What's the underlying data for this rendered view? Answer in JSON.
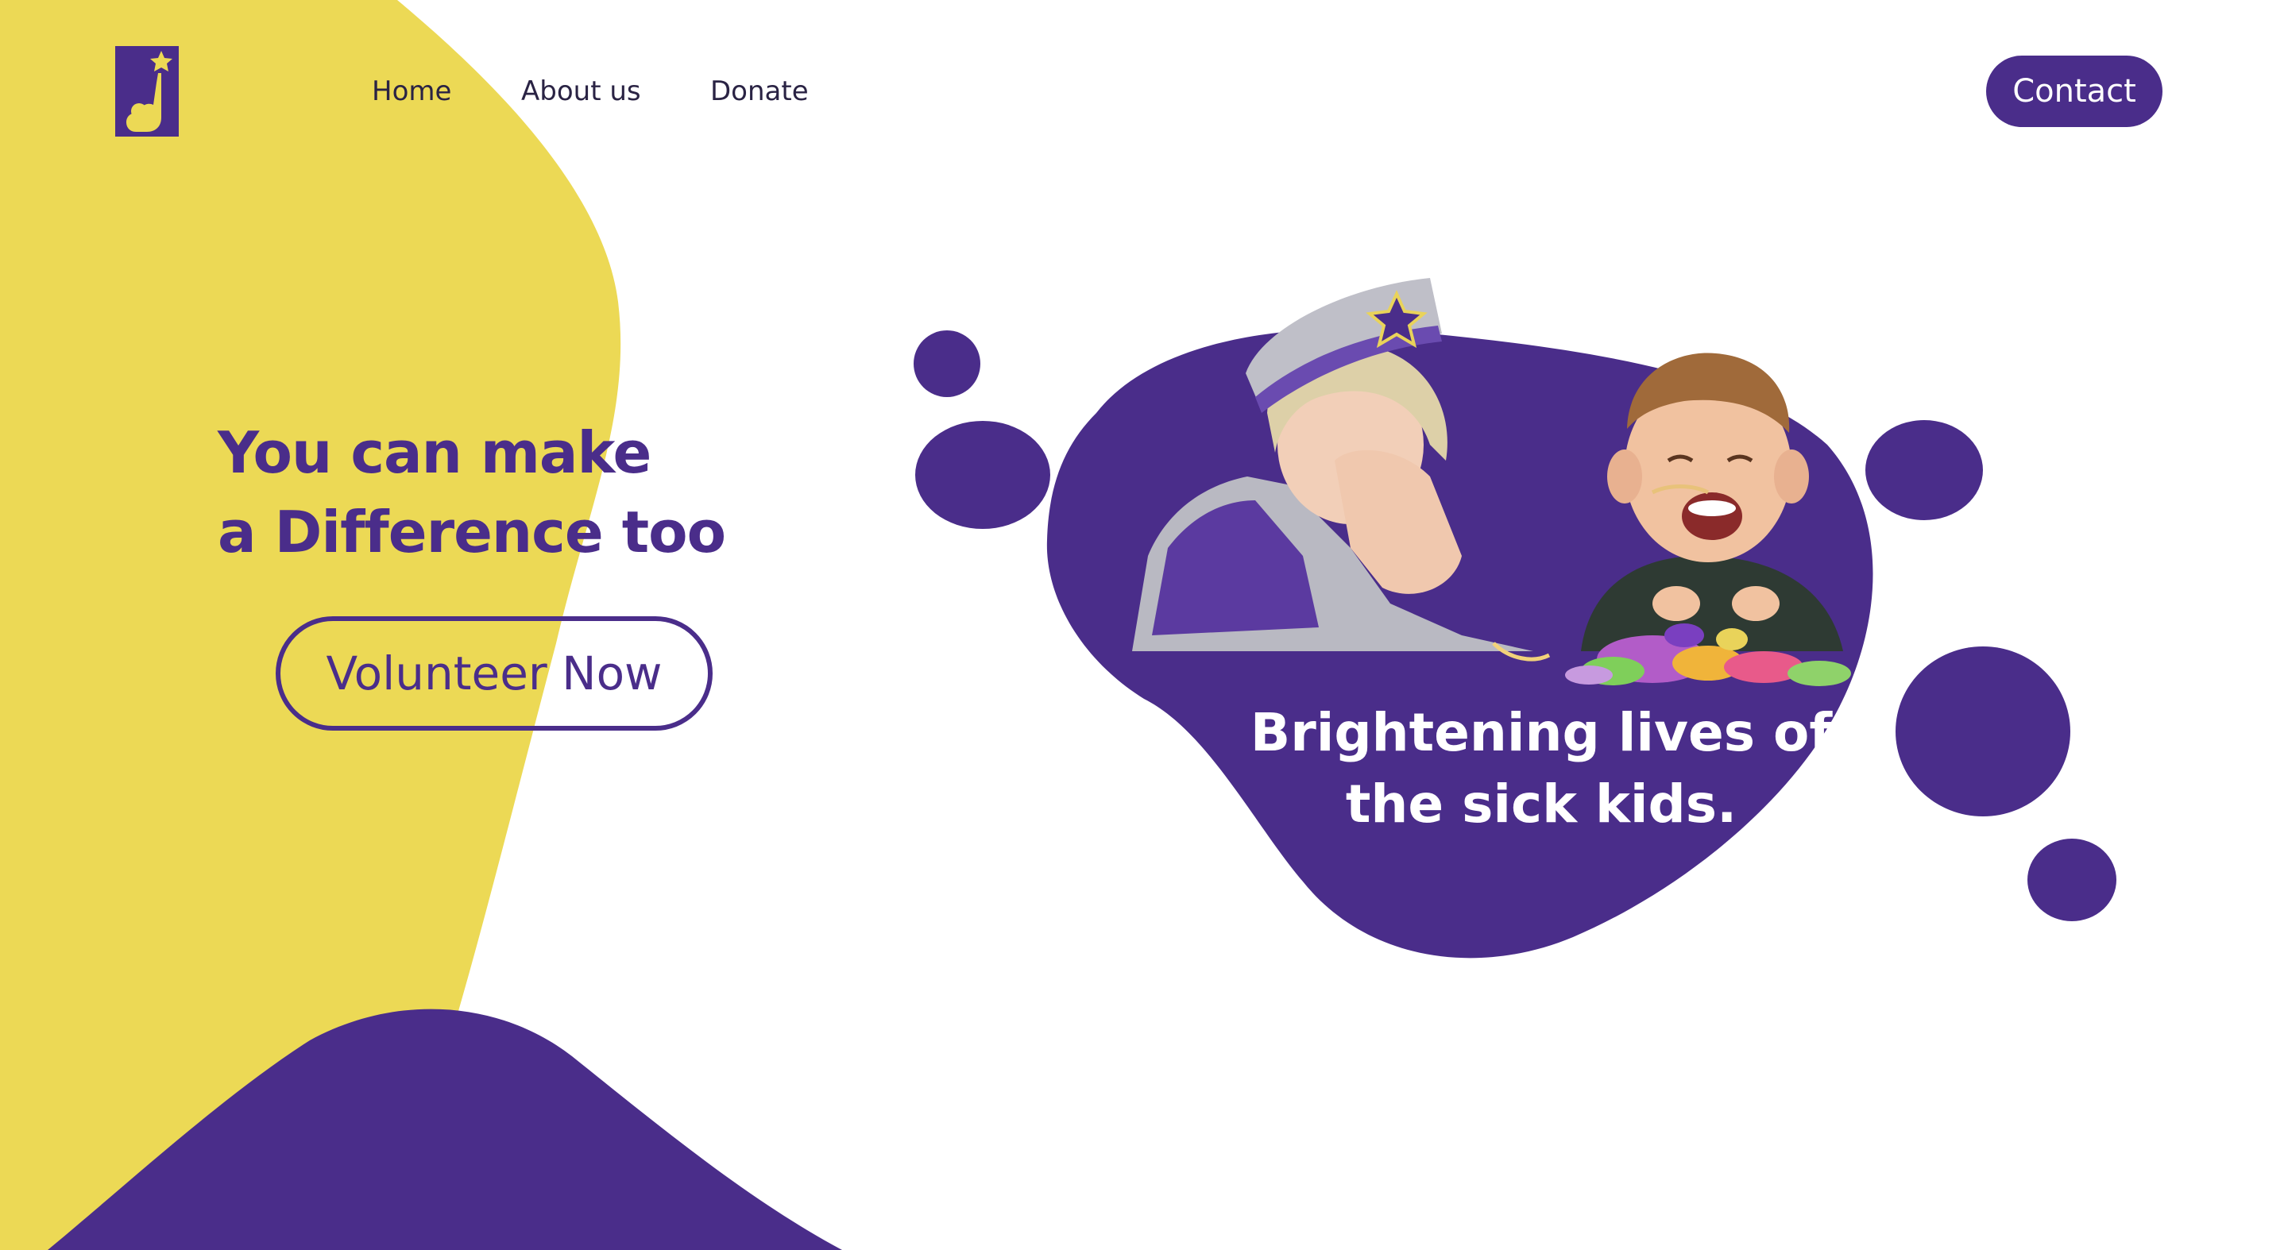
{
  "brand": {
    "logo_icon": "child-reaching-star-logo-icon",
    "primary_color": "#4a2d8a",
    "accent_color": "#ecd955"
  },
  "nav": {
    "items": [
      {
        "label": "Home"
      },
      {
        "label": "About us"
      },
      {
        "label": "Donate"
      }
    ],
    "contact_label": "Contact"
  },
  "hero": {
    "headline_line1": "You can make",
    "headline_line2": "a Difference too",
    "cta_label": "Volunteer Now",
    "caption_line1": "Brightening lives of",
    "caption_line2": "the sick kids.",
    "photo_icon": "volunteer-and-child-photo"
  }
}
